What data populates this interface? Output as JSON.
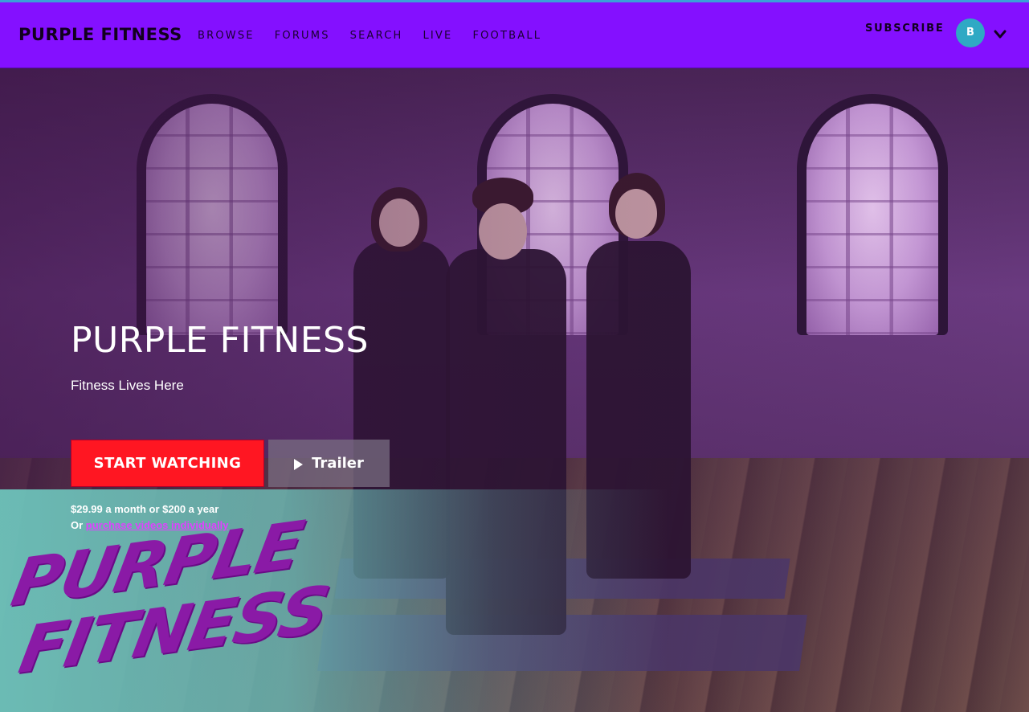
{
  "nav": {
    "brand": "PURPLE FITNESS",
    "links": [
      "BROWSE",
      "FORUMS",
      "SEARCH",
      "LIVE",
      "FOOTBALL"
    ],
    "subscribe": "SUBSCRIBE",
    "avatar_initial": "B",
    "menu_icon": "chevron-down-icon"
  },
  "hero": {
    "title": "PURPLE FITNESS",
    "tagline": "Fitness Lives Here",
    "start_button": "START WATCHING",
    "trailer_button": "Trailer",
    "trailer_icon": "play-icon",
    "price": "$29.99 a month or $200 a year",
    "or_prefix": "Or ",
    "purchase_link": "purchase videos individually"
  },
  "logo_art": {
    "line1": "PURPLE",
    "line2": "FITNESS"
  },
  "colors": {
    "navbar": "#8410ff",
    "start_button": "#ff1622",
    "link": "#e040ff",
    "avatar": "#2fa9c4",
    "logo": "#8a1aa6"
  }
}
